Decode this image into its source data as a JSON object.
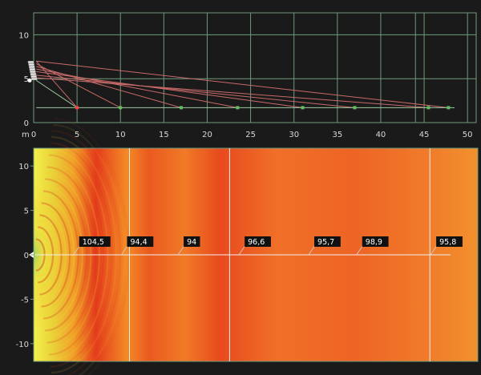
{
  "top_plot": {
    "x_unit": "m",
    "x_ticks": [
      "0",
      "5",
      "10",
      "15",
      "20",
      "25",
      "30",
      "35",
      "40",
      "45",
      "50"
    ],
    "y_ticks": [
      "10",
      "5",
      "0"
    ],
    "x_range": [
      0,
      51
    ],
    "y_range": [
      0,
      12.5
    ],
    "source": {
      "x": 0,
      "y": 6.8
    },
    "receivers": [
      {
        "x": 5,
        "y": 1.7,
        "color": "#ff4040"
      },
      {
        "x": 10,
        "y": 1.7,
        "color": "#60c060"
      },
      {
        "x": 17,
        "y": 1.7,
        "color": "#60c060"
      },
      {
        "x": 23.5,
        "y": 1.7,
        "color": "#60c060"
      },
      {
        "x": 31,
        "y": 1.7,
        "color": "#60c060"
      },
      {
        "x": 37,
        "y": 1.7,
        "color": "#60c060"
      },
      {
        "x": 45.5,
        "y": 1.7,
        "color": "#60c060"
      },
      {
        "x": 47.8,
        "y": 1.7,
        "color": "#60c060"
      }
    ]
  },
  "heatmap": {
    "y_ticks": [
      "10",
      "5",
      "0",
      "-5",
      "-10"
    ],
    "y_range": [
      -12,
      12
    ],
    "x_range": [
      0,
      51
    ],
    "section_lines_x": [
      11,
      22.5,
      45.5
    ],
    "labels": [
      {
        "text": "104,5",
        "x": 5.5
      },
      {
        "text": "94,4",
        "x": 11
      },
      {
        "text": "94",
        "x": 17.5
      },
      {
        "text": "96,6",
        "x": 24.5
      },
      {
        "text": "95,7",
        "x": 32.5
      },
      {
        "text": "98,9",
        "x": 38
      },
      {
        "text": "95,8",
        "x": 46.5
      }
    ]
  },
  "colors": {
    "background": "#1a1a1a",
    "grid": "#6f9a7a",
    "ray": "#c86a6a",
    "label_bg": "#111111"
  }
}
